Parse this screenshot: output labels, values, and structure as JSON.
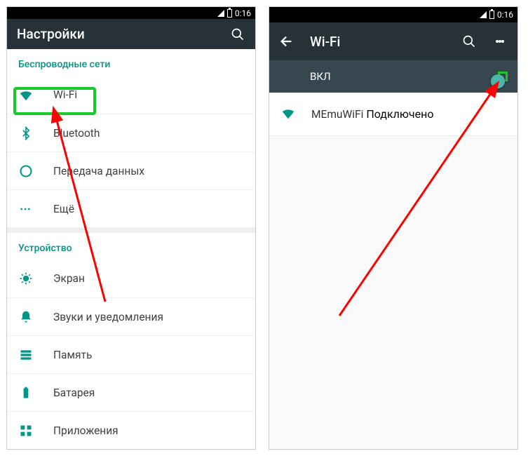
{
  "statusbar": {
    "time": "0:16"
  },
  "left": {
    "title": "Настройки",
    "section_wireless": "Беспроводные сети",
    "wifi": "Wi-Fi",
    "bluetooth": "Bluetooth",
    "data": "Передача данных",
    "more": "Ещё",
    "section_device": "Устройство",
    "display": "Экран",
    "sound": "Звуки и уведомления",
    "storage": "Память",
    "battery": "Батарея",
    "apps": "Приложения"
  },
  "right": {
    "title": "Wi-Fi",
    "toggle_label": "ВКЛ",
    "network_name": "MEmuWiFi",
    "network_status": "Подключено"
  }
}
